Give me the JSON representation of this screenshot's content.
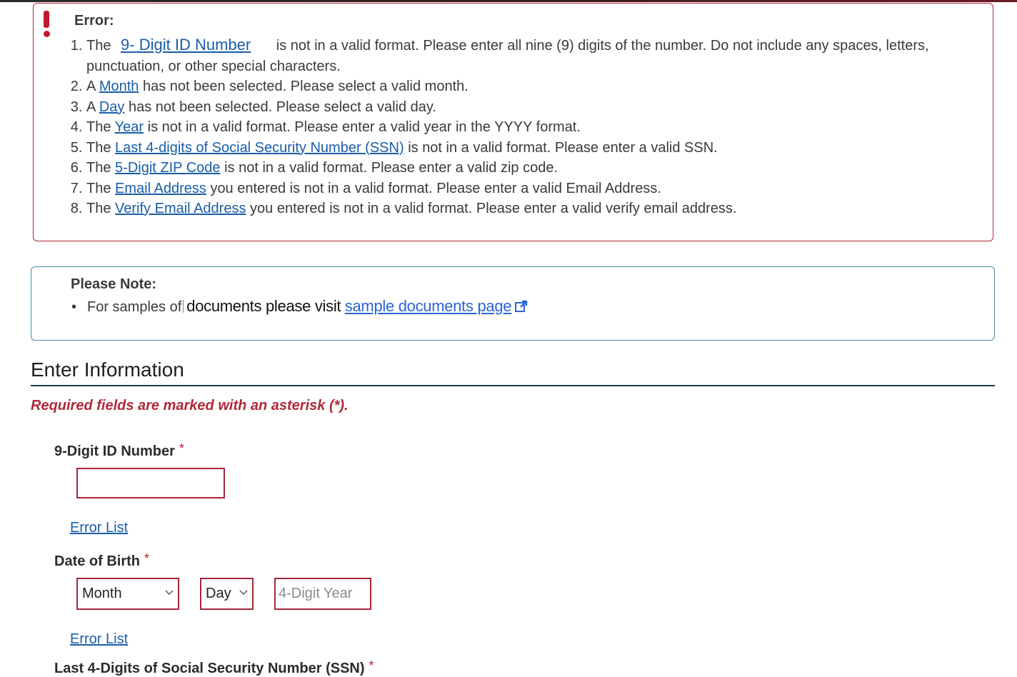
{
  "error_box": {
    "title": "Error:",
    "items": [
      {
        "num": "1.",
        "pre": "The",
        "link": "9- Digit ID Number",
        "post": "is not in a valid format. Please enter all nine (9) digits of the number. Do not include any spaces, letters, punctuation, or other special characters."
      },
      {
        "num": "2.",
        "pre": "A",
        "link": "Month",
        "post": "has not been selected. Please select a valid month."
      },
      {
        "num": "3.",
        "pre": "A",
        "link": "Day",
        "post": "has not been selected. Please select a valid day."
      },
      {
        "num": "4.",
        "pre": "The",
        "link": "Year",
        "post": "is not in a valid format. Please enter a valid year in the YYYY format."
      },
      {
        "num": "5.",
        "pre": "The",
        "link": "Last 4-digits of Social Security Number (SSN)",
        "post": "is not in a valid format. Please enter a valid SSN."
      },
      {
        "num": "6.",
        "pre": "The",
        "link": "5-Digit ZIP Code",
        "post": "is not in a valid format. Please enter a valid zip code."
      },
      {
        "num": "7.",
        "pre": "The",
        "link": "Email Address",
        "post": "you entered is not in a valid format. Please enter a valid Email Address."
      },
      {
        "num": "8.",
        "pre": "The",
        "link": "Verify Email Address",
        "post": "you entered is not in a valid format. Please enter a valid verify email address."
      }
    ]
  },
  "note_box": {
    "title": "Please Note:",
    "prefix": "For samples of",
    "middle": "documents please visit",
    "link": "sample documents page"
  },
  "section": {
    "title": "Enter Information",
    "required_note": "Required fields are marked with an asterisk (*)."
  },
  "fields": {
    "id_number": {
      "label": "9-Digit ID Number",
      "asterisk": "*",
      "value": "",
      "error_link": "Error List"
    },
    "dob": {
      "label": "Date of Birth",
      "asterisk": "*",
      "month_value": "Month",
      "day_value": "Day",
      "year_placeholder": "4-Digit Year",
      "error_link": "Error List"
    },
    "ssn": {
      "label": "Last 4-Digits of Social Security Number (SSN)",
      "asterisk": "*"
    }
  },
  "colors": {
    "error": "#b0283a",
    "link": "#1a5da6",
    "note_border": "#4a8aa2",
    "heading_rule": "#1a3d52"
  }
}
